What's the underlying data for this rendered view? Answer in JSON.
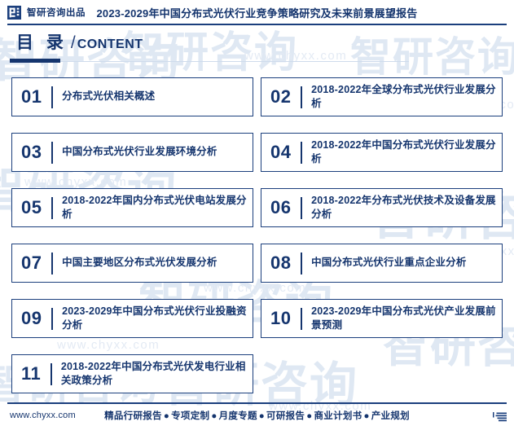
{
  "header": {
    "brand_logo_icon": "zhiyan-logo-icon",
    "brand_name": "智研咨询出品",
    "report_title": "2023-2029年中国分布式光伏行业竞争策略研究及未来前景展望报告"
  },
  "section": {
    "title_cn": "目 录",
    "title_slash": "/",
    "title_en": "CONTENT"
  },
  "toc": {
    "items": [
      {
        "num": "01",
        "text": "分布式光伏相关概述"
      },
      {
        "num": "02",
        "text": "2018-2022年全球分布式光伏行业发展分析"
      },
      {
        "num": "03",
        "text": "中国分布式光伏行业发展环境分析"
      },
      {
        "num": "04",
        "text": "2018-2022年中国分布式光伏行业发展分析"
      },
      {
        "num": "05",
        "text": "2018-2022年国内分布式光伏电站发展分析"
      },
      {
        "num": "06",
        "text": "2018-2022年分布式光伏技术及设备发展分析"
      },
      {
        "num": "07",
        "text": "中国主要地区分布式光伏发展分析"
      },
      {
        "num": "08",
        "text": "中国分布式光伏行业重点企业分析"
      },
      {
        "num": "09",
        "text": "2023-2029年中国分布式光伏行业投融资分析"
      },
      {
        "num": "10",
        "text": "2023-2029年中国分布式光伏产业发展前景预测"
      },
      {
        "num": "11",
        "text": "2018-2022年中国分布式光伏发电行业相关政策分析"
      }
    ]
  },
  "footer": {
    "url": "www.chyxx.com",
    "services": [
      "精品行研报告",
      "专项定制",
      "月度专题",
      "可研报告",
      "商业计划书",
      "产业规划"
    ],
    "separator": "●",
    "right_icon": "stacked-layers-icon"
  },
  "watermark": {
    "logo_text": "智研咨询",
    "url_text": "www.chyxx.com"
  },
  "colors": {
    "navy": "#15356e",
    "border": "#1b3f7d",
    "watermark": "#dfe8f3",
    "background": "#ffffff"
  }
}
